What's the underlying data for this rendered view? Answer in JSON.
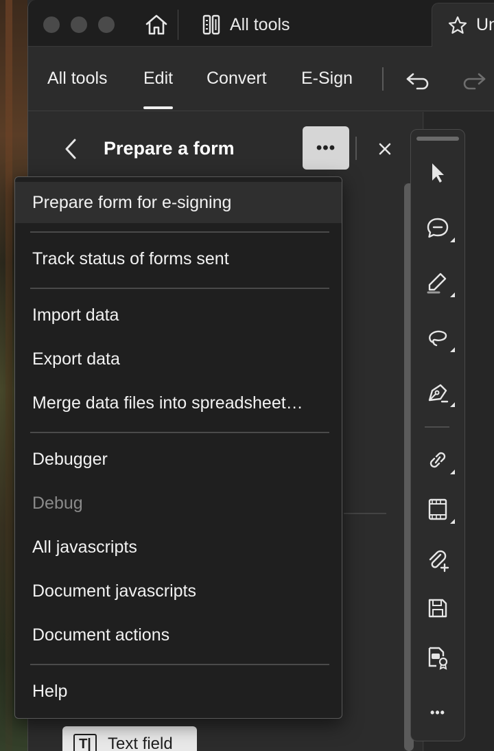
{
  "titlebar": {
    "all_tools_label": "All tools",
    "doc_tab_label": "Un"
  },
  "menubar": {
    "items": [
      {
        "label": "All tools",
        "active": false
      },
      {
        "label": "Edit",
        "active": true
      },
      {
        "label": "Convert",
        "active": false
      },
      {
        "label": "E-Sign",
        "active": false
      }
    ]
  },
  "panel": {
    "title": "Prepare a form",
    "more_label": "•••",
    "text_field_label": "Text field",
    "text_field_icon_label": "T|"
  },
  "dropdown": {
    "items": [
      {
        "label": "Prepare form for e-signing"
      },
      {
        "label": "Track status of forms sent"
      },
      {
        "label": "Import data"
      },
      {
        "label": "Export data"
      },
      {
        "label": "Merge data files into spreadsheet…"
      },
      {
        "label": "Debugger"
      },
      {
        "label": "Debug"
      },
      {
        "label": "All javascripts"
      },
      {
        "label": "Document javascripts"
      },
      {
        "label": "Document actions"
      },
      {
        "label": "Help"
      }
    ]
  },
  "rail": {
    "more_label": "•••"
  },
  "colors": {
    "background": "#2c2c2c",
    "titlebar": "#1e1e1e",
    "menu_bg": "#1f1f1f",
    "highlight_button": "#d6d6d6"
  }
}
